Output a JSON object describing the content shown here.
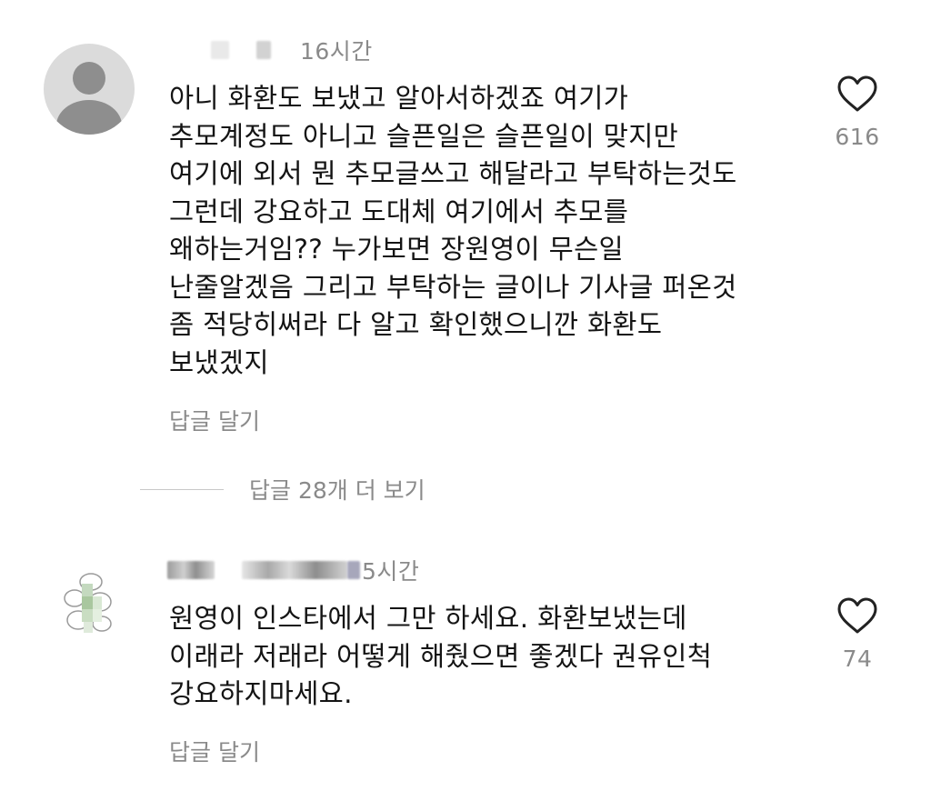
{
  "comments": [
    {
      "time": "16시간",
      "text": "아니 화환도 보냈고 알아서하겠죠 여기가\n추모계정도 아니고 슬픈일은 슬픈일이 맞지만\n여기에 외서 뭔 추모글쓰고 해달라고 부탁하는것도\n그런데 강요하고 도대체 여기에서 추모를\n왜하는거임?? 누가보면 장원영이 무슨일\n난줄알겠음 그리고 부탁하는 글이나 기사글 퍼온것\n좀 적당히써라 다 알고 확인했으니깐 화환도\n보냈겠지",
      "reply_label": "답글 달기",
      "like_count": "616",
      "like_icon": "heart-outline-icon"
    },
    {
      "time": "5시간",
      "text": "원영이 인스타에서 그만 하세요. 화환보냈는데\n이래라 저래라 어떻게 해줬으면 좋겠다 권유인척\n강요하지마세요.",
      "reply_label": "답글 달기",
      "like_count": "74",
      "like_icon": "heart-outline-icon"
    }
  ],
  "more_replies": {
    "label": "답글 28개 더 보기"
  },
  "colors": {
    "text": "#141414",
    "muted": "#8a8a8a",
    "divider": "#c8c8c8",
    "avatar_bg": "#dbdbdb",
    "avatar_fg": "#8e8e8e"
  }
}
